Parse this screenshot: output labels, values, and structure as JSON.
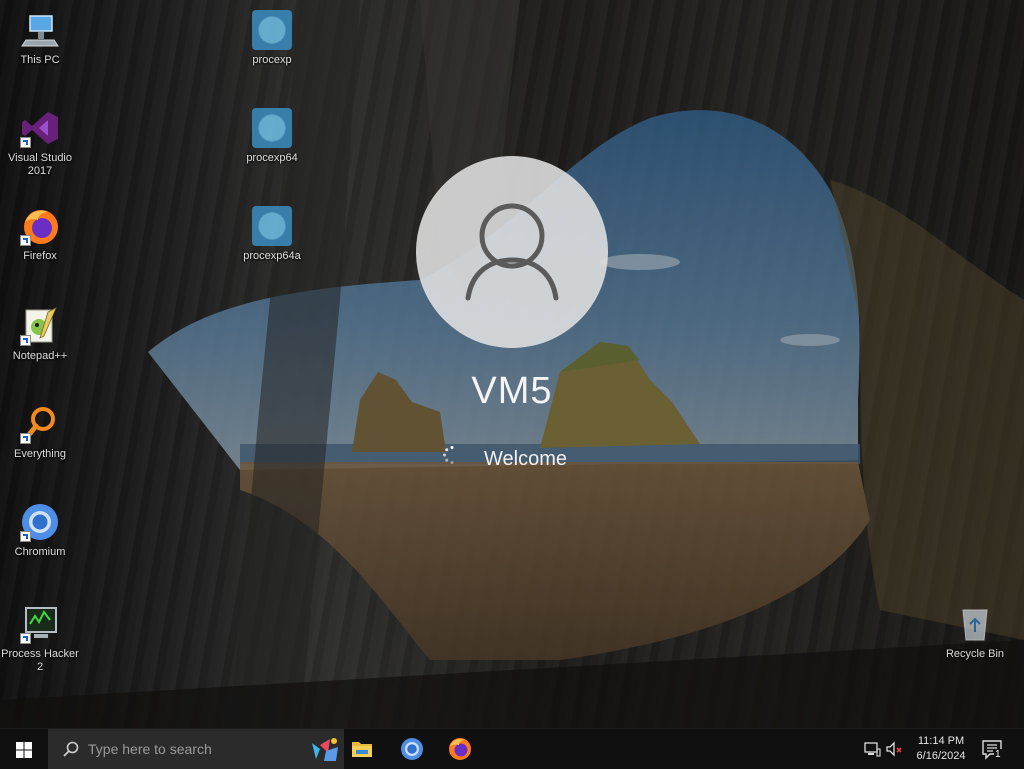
{
  "desktop": {
    "icons": [
      {
        "label": "This PC",
        "icon": "this-pc-icon"
      },
      {
        "label": "Visual Studio 2017",
        "icon": "visual-studio-icon"
      },
      {
        "label": "Firefox",
        "icon": "firefox-icon"
      },
      {
        "label": "Notepad++",
        "icon": "notepadpp-icon"
      },
      {
        "label": "Everything",
        "icon": "everything-icon"
      },
      {
        "label": "Chromium",
        "icon": "chromium-icon"
      },
      {
        "label": "Process Hacker 2",
        "icon": "process-hacker-icon"
      },
      {
        "label": "procexp",
        "icon": "procexp-icon"
      },
      {
        "label": "procexp64",
        "icon": "procexp-icon"
      },
      {
        "label": "procexp64a",
        "icon": "procexp-icon"
      },
      {
        "label": "Recycle Bin",
        "icon": "recycle-bin-icon"
      }
    ]
  },
  "login": {
    "username": "VM5",
    "status": "Welcome"
  },
  "taskbar": {
    "search_placeholder": "Type here to search",
    "pinned_apps": [
      "file-explorer-icon",
      "chromium-icon",
      "firefox-icon"
    ],
    "tray": {
      "time": "11:14 PM",
      "date": "6/16/2024",
      "icons": [
        "network-icon",
        "volume-muted-icon",
        "notification-icon"
      ],
      "notification_count": "1"
    }
  },
  "colors": {
    "taskbar_bg": "#101010",
    "search_bg": "#2b2b2b",
    "avatar_bg": "#e1e1e1"
  }
}
